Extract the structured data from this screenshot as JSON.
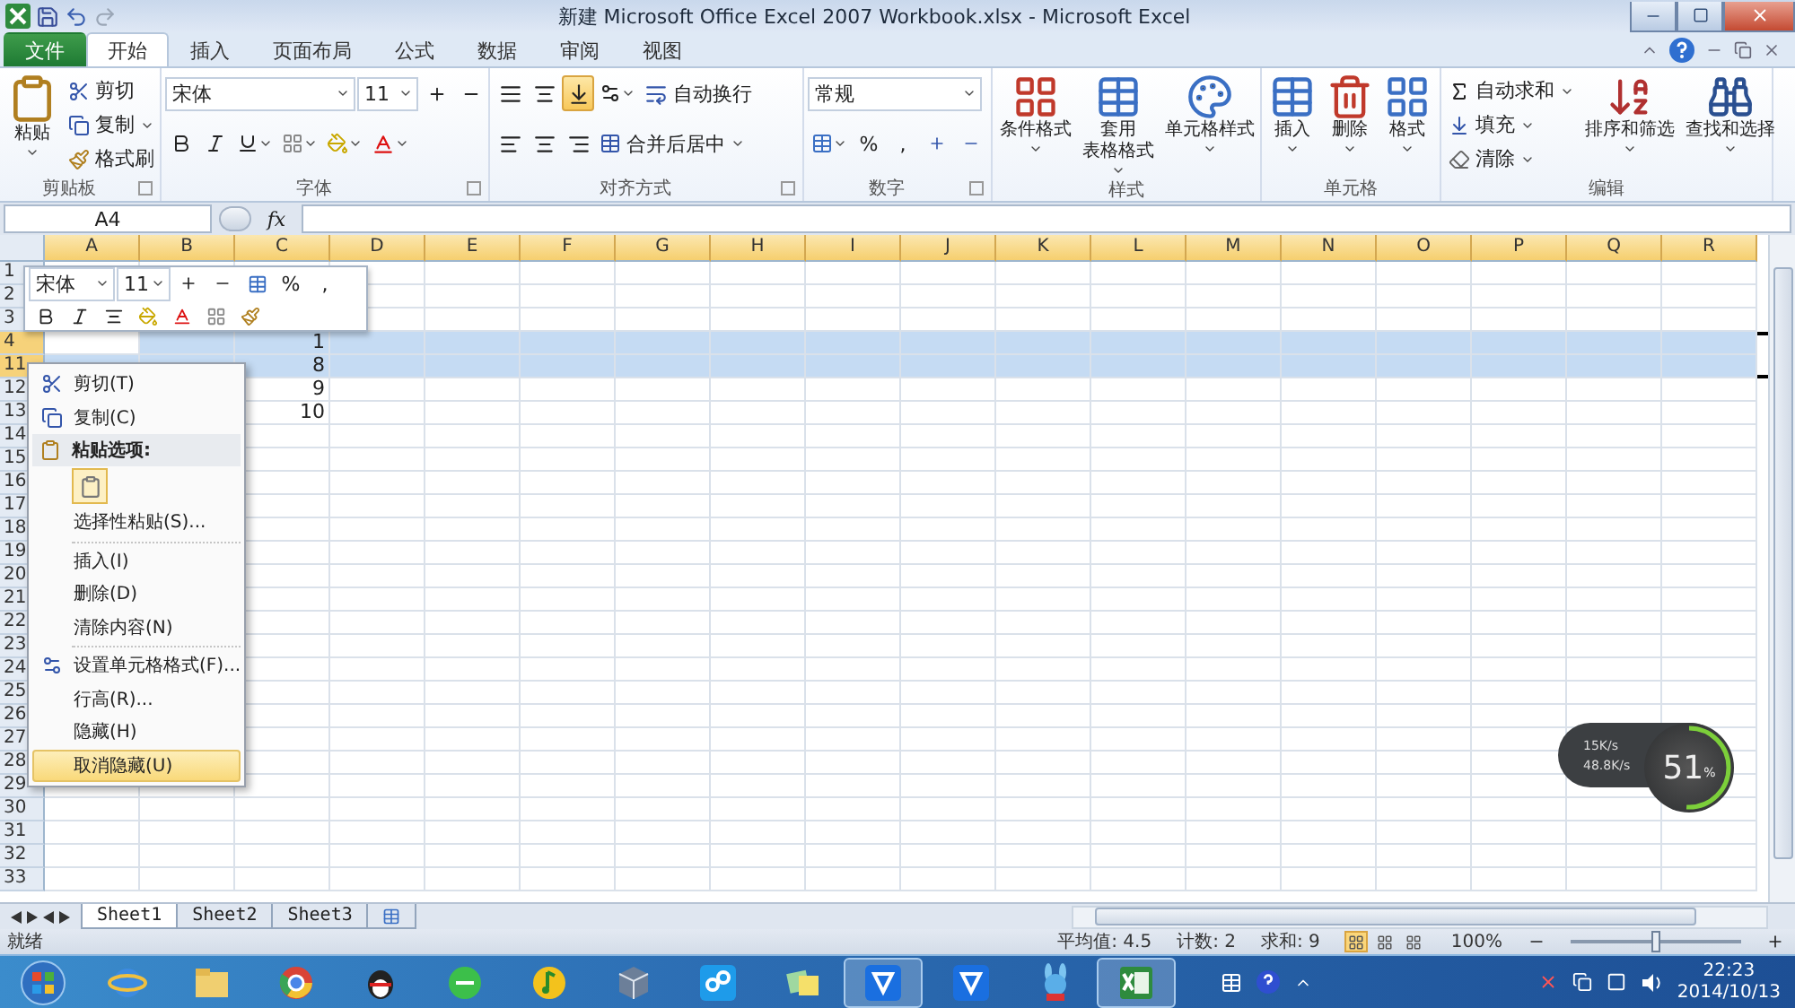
{
  "title_bar": {
    "title": "新建 Microsoft Office Excel 2007 Workbook.xlsx - Microsoft Excel"
  },
  "tabs": [
    {
      "label": "文件",
      "kind": "file",
      "selected": false
    },
    {
      "label": "开始",
      "kind": "tab",
      "selected": true
    },
    {
      "label": "插入",
      "kind": "tab",
      "selected": false
    },
    {
      "label": "页面布局",
      "kind": "tab",
      "selected": false
    },
    {
      "label": "公式",
      "kind": "tab",
      "selected": false
    },
    {
      "label": "数据",
      "kind": "tab",
      "selected": false
    },
    {
      "label": "审阅",
      "kind": "tab",
      "selected": false
    },
    {
      "label": "视图",
      "kind": "tab",
      "selected": false
    }
  ],
  "ribbon": {
    "clipboard": {
      "name": "剪贴板",
      "paste": "粘贴",
      "cut": "剪切",
      "copy": "复制",
      "format_painter": "格式刷"
    },
    "font": {
      "name": "字体",
      "font_name": "宋体",
      "font_size": "11"
    },
    "alignment": {
      "name": "对齐方式",
      "vertical": [
        {
          "selected": false
        },
        {
          "selected": false
        },
        {
          "selected": true
        }
      ],
      "wrap": "自动换行",
      "merge": "合并后居中"
    },
    "number": {
      "name": "数字",
      "format": "常规",
      "percent": "%",
      "comma": ","
    },
    "styles": {
      "name": "样式",
      "items": [
        {
          "lines": [
            "条件格式"
          ]
        },
        {
          "lines": [
            "套用",
            "表格格式"
          ]
        },
        {
          "lines": [
            "单元格样式"
          ]
        }
      ]
    },
    "cells": {
      "name": "单元格",
      "items": [
        {
          "lines": [
            "插入"
          ]
        },
        {
          "lines": [
            "删除"
          ]
        },
        {
          "lines": [
            "格式"
          ]
        }
      ]
    },
    "editing": {
      "name": "编辑",
      "autosum": "自动求和",
      "fill": "填充",
      "clear": "清除",
      "sort": "排序和筛选",
      "find": "查找和选择"
    }
  },
  "formula_bar": {
    "name_box": "A4",
    "function_label": "fx"
  },
  "columns": [
    "A",
    "B",
    "C",
    "D",
    "E",
    "F",
    "G",
    "H",
    "I",
    "J",
    "K",
    "L",
    "M",
    "N",
    "O",
    "P",
    "Q",
    "R"
  ],
  "rows": [
    {
      "header": "1",
      "selected": false
    },
    {
      "header": "2",
      "selected": false
    },
    {
      "header": "3",
      "selected": false
    },
    {
      "header": "4",
      "selected": true,
      "column_c": "1"
    },
    {
      "header": "11",
      "selected": true,
      "column_c": "8"
    },
    {
      "header": "12",
      "selected": false,
      "column_c": "9"
    },
    {
      "header": "13",
      "selected": false,
      "column_c": "10"
    },
    {
      "header": "14",
      "selected": false
    },
    {
      "header": "15",
      "selected": false
    },
    {
      "header": "16",
      "selected": false
    },
    {
      "header": "17",
      "selected": false
    },
    {
      "header": "18",
      "selected": false
    },
    {
      "header": "19",
      "selected": false
    },
    {
      "header": "20",
      "selected": false
    },
    {
      "header": "21",
      "selected": false
    },
    {
      "header": "22",
      "selected": false
    },
    {
      "header": "23",
      "selected": false
    },
    {
      "header": "24",
      "selected": false
    },
    {
      "header": "25",
      "selected": false
    },
    {
      "header": "26",
      "selected": false
    },
    {
      "header": "27",
      "selected": false
    },
    {
      "header": "28",
      "selected": false
    },
    {
      "header": "29",
      "selected": false
    },
    {
      "header": "30",
      "selected": false
    },
    {
      "header": "31",
      "selected": false
    },
    {
      "header": "32",
      "selected": false
    },
    {
      "header": "33",
      "selected": false
    }
  ],
  "mini_toolbar": {
    "font_name": "宋体",
    "font_size": "11",
    "percent": "%",
    "comma": ","
  },
  "context_menu": {
    "items": [
      {
        "kind": "item",
        "label": "剪切(T)",
        "selected": false
      },
      {
        "kind": "item",
        "label": "复制(C)",
        "selected": false
      },
      {
        "kind": "header",
        "label": "粘贴选项:"
      },
      {
        "kind": "paste_options"
      },
      {
        "kind": "item",
        "label": "选择性粘贴(S)...",
        "selected": false
      },
      {
        "kind": "separator"
      },
      {
        "kind": "item",
        "label": "插入(I)",
        "selected": false
      },
      {
        "kind": "item",
        "label": "删除(D)",
        "selected": false
      },
      {
        "kind": "item",
        "label": "清除内容(N)",
        "selected": false
      },
      {
        "kind": "separator"
      },
      {
        "kind": "item",
        "label": "设置单元格格式(F)...",
        "selected": false
      },
      {
        "kind": "item",
        "label": "行高(R)...",
        "selected": false
      },
      {
        "kind": "item",
        "label": "隐藏(H)",
        "selected": false
      },
      {
        "kind": "item",
        "label": "取消隐藏(U)",
        "selected": true
      }
    ]
  },
  "sheet_tabs": [
    {
      "label": "Sheet1",
      "selected": true
    },
    {
      "label": "Sheet2",
      "selected": false
    },
    {
      "label": "Sheet3",
      "selected": false
    }
  ],
  "status_bar": {
    "status": "就绪",
    "stats": [
      "平均值: 4.5",
      "计数: 2",
      "求和: 9"
    ],
    "views": [
      {
        "selected": true
      },
      {
        "selected": false
      },
      {
        "selected": false
      }
    ],
    "zoom": "100%",
    "zoom_slider": {
      "level": 0.5
    }
  },
  "taskbar": {
    "items": [
      {
        "selected": false
      },
      {
        "selected": false
      },
      {
        "selected": false
      },
      {
        "selected": false
      },
      {
        "selected": false
      },
      {
        "selected": false
      },
      {
        "selected": false
      },
      {
        "selected": false
      },
      {
        "selected": false
      },
      {
        "selected": true
      },
      {
        "selected": false
      },
      {
        "selected": false
      },
      {
        "selected": true
      }
    ],
    "time": "22:23",
    "date": "2014/10/13"
  },
  "network_widget": {
    "upload": "15K/s",
    "download": "48.8K/s",
    "value": "51",
    "unit": "%",
    "level": 0.51
  }
}
